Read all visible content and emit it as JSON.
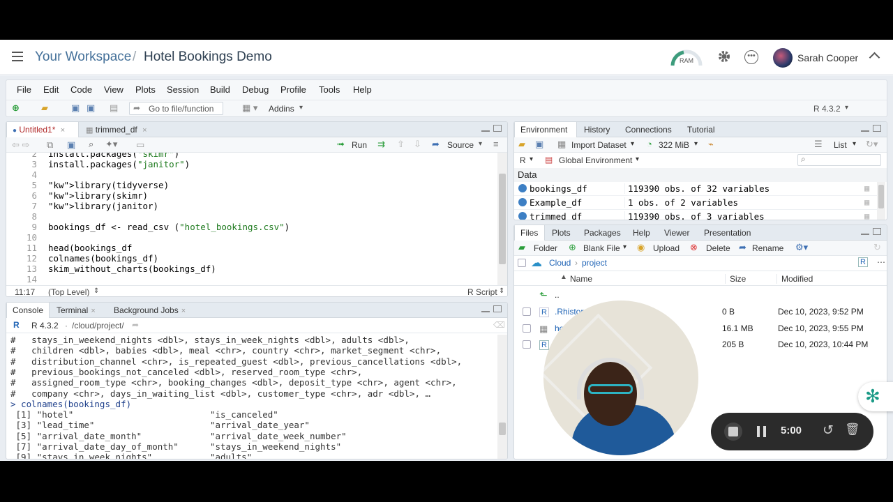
{
  "header": {
    "workspace": "Your Workspace",
    "separator": "/",
    "project": "Hotel Bookings Demo",
    "ram_label": "RAM",
    "user_name": "Sarah Cooper"
  },
  "menu": {
    "items": [
      "File",
      "Edit",
      "Code",
      "View",
      "Plots",
      "Session",
      "Build",
      "Debug",
      "Profile",
      "Tools",
      "Help"
    ],
    "goto_placeholder": "Go to file/function",
    "addins": "Addins",
    "r_version": "R 4.3.2"
  },
  "editor": {
    "tabs": [
      "Untitled1*",
      "trimmed_df"
    ],
    "run_label": "Run",
    "source_label": "Source",
    "lines": [
      {
        "n": "2",
        "t": "install.packages(\"skimr\")"
      },
      {
        "n": "3",
        "t": "install.packages(\"janitor\")"
      },
      {
        "n": "4",
        "t": ""
      },
      {
        "n": "5",
        "t": "library(tidyverse)"
      },
      {
        "n": "6",
        "t": "library(skimr)"
      },
      {
        "n": "7",
        "t": "library(janitor)"
      },
      {
        "n": "8",
        "t": ""
      },
      {
        "n": "9",
        "t": "bookings_df <- read_csv (\"hotel_bookings.csv\")"
      },
      {
        "n": "10",
        "t": ""
      },
      {
        "n": "11",
        "t": "head(bookings_df"
      },
      {
        "n": "12",
        "t": "colnames(bookings_df)"
      },
      {
        "n": "13",
        "t": "skim_without_charts(bookings_df)"
      },
      {
        "n": "14",
        "t": ""
      }
    ],
    "status_pos": "11:17",
    "status_scope": "(Top Level)",
    "status_type": "R Script"
  },
  "console": {
    "tabs": [
      "Console",
      "Terminal",
      "Background Jobs"
    ],
    "r_version": "R 4.3.2",
    "path": "/cloud/project/",
    "lines": [
      "#   stays_in_weekend_nights <dbl>, stays_in_week_nights <dbl>, adults <dbl>,",
      "#   children <dbl>, babies <dbl>, meal <chr>, country <chr>, market_segment <chr>,",
      "#   distribution_channel <chr>, is_repeated_guest <dbl>, previous_cancellations <dbl>,",
      "#   previous_bookings_not_canceled <dbl>, reserved_room_type <chr>,",
      "#   assigned_room_type <chr>, booking_changes <dbl>, deposit_type <chr>, agent <chr>,",
      "#   company <chr>, days_in_waiting_list <dbl>, customer_type <chr>, adr <dbl>, …",
      "> colnames(bookings_df)",
      " [1] \"hotel\"                          \"is_canceled\"",
      " [3] \"lead_time\"                      \"arrival_date_year\"",
      " [5] \"arrival_date_month\"             \"arrival_date_week_number\"",
      " [7] \"arrival_date_day_of_month\"      \"stays_in_weekend_nights\"",
      " [9] \"stays_in_week_nights\"           \"adults\""
    ]
  },
  "environment": {
    "tabs": [
      "Environment",
      "History",
      "Connections",
      "Tutorial"
    ],
    "import_label": "Import Dataset",
    "memory": "322 MiB",
    "view_mode": "List",
    "lang": "R",
    "scope": "Global Environment",
    "section": "Data",
    "rows": [
      {
        "name": "bookings_df",
        "value": "119390 obs. of 32 variables"
      },
      {
        "name": "Example_df",
        "value": "1 obs. of 2 variables"
      },
      {
        "name": "trimmed_df",
        "value": "119390 obs. of 3 variables"
      }
    ]
  },
  "files": {
    "tabs": [
      "Files",
      "Plots",
      "Packages",
      "Help",
      "Viewer",
      "Presentation"
    ],
    "actions": [
      "Folder",
      "Blank File",
      "Upload",
      "Delete",
      "Rename"
    ],
    "breadcrumb": [
      "Cloud",
      "project"
    ],
    "columns": [
      "Name",
      "Size",
      "Modified"
    ],
    "up": "..",
    "rows": [
      {
        "name": ".Rhistory",
        "size": "0 B",
        "modified": "Dec 10, 2023, 9:52 PM"
      },
      {
        "name": "hotel_bookings.csv",
        "size": "16.1 MB",
        "modified": "Dec 10, 2023, 9:55 PM"
      },
      {
        "name": "",
        "size": "205 B",
        "modified": "Dec 10, 2023, 10:44 PM"
      }
    ]
  },
  "recorder": {
    "time": "5:00"
  },
  "colors": {
    "accent": "#447099",
    "keyword": "#2b5aa3",
    "string": "#1e7a1e",
    "recorder_bg": "#2b2b2b"
  }
}
